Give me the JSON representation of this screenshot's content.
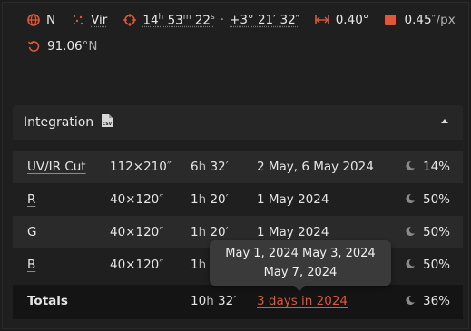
{
  "header": {
    "direction": "N",
    "constellation": "Vir",
    "ra_h": "14",
    "ra_h_unit": "h",
    "ra_m": "53",
    "ra_m_unit": "m",
    "ra_s": "22",
    "ra_s_unit": "s",
    "dot": "·",
    "dec": "+3° 21′ 32″",
    "fov": "0.40°",
    "pixscale_value": "0.45",
    "pixscale_unit": "″/px",
    "rotation_value": "91.06",
    "rotation_unit": "°N"
  },
  "panel": {
    "title": "Integration",
    "csv_label": "CSV"
  },
  "rows": [
    {
      "name": "UV/IR Cut",
      "exposure": "112×210",
      "exp_unit": "″",
      "time_h": "6",
      "time_h_unit": "h",
      "time_m": " 32",
      "time_m_unit": "′",
      "dates": "2 May, 6 May 2024",
      "moon": "14%"
    },
    {
      "name": "R",
      "exposure": "40×120",
      "exp_unit": "″",
      "time_h": "1",
      "time_h_unit": "h",
      "time_m": " 20",
      "time_m_unit": "′",
      "dates": "1 May 2024",
      "moon": "50%"
    },
    {
      "name": "G",
      "exposure": "40×120",
      "exp_unit": "″",
      "time_h": "1",
      "time_h_unit": "h",
      "time_m": " 20",
      "time_m_unit": "′",
      "dates": "1 May 2024",
      "moon": "50%"
    },
    {
      "name": "B",
      "exposure": "40×120",
      "exp_unit": "″",
      "time_h": "1",
      "time_h_unit": "h",
      "time_m": "",
      "time_m_unit": "",
      "dates": "",
      "moon": "50%"
    }
  ],
  "totals": {
    "label": "Totals",
    "time_h": "10",
    "time_h_unit": "h",
    "time_m": " 32",
    "time_m_unit": "′",
    "dates": "3 days in 2024",
    "moon": "36%"
  },
  "tooltip": {
    "line1": "May 1, 2024 May 3, 2024",
    "line2": "May 7, 2024"
  },
  "colors": {
    "accent_red": "#e0573b",
    "background": "#1f1f1f"
  },
  "icons": [
    "globe-icon",
    "constellation-icon",
    "crosshair-icon",
    "width-icon",
    "square-icon",
    "rotate-icon",
    "csv-file-icon",
    "caret-up-icon",
    "moon-icon"
  ]
}
